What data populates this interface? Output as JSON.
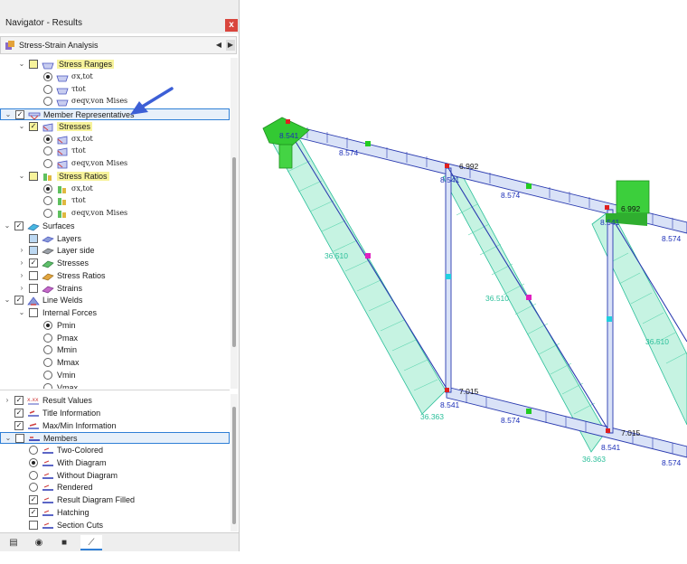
{
  "panel": {
    "title": "Navigator - Results",
    "close": "x",
    "module": "Stress-Strain Analysis"
  },
  "tree_top": [
    {
      "t": "check",
      "label": "Stress Ranges",
      "exp": "v",
      "checked": false,
      "hl": true,
      "lvl": 1,
      "icon": "stress-range-icon"
    },
    {
      "t": "radio",
      "label": "σx,tot",
      "on": true,
      "lvl": 2,
      "icon": "stress-range-icon"
    },
    {
      "t": "radio",
      "label": "τtot",
      "on": false,
      "lvl": 2,
      "icon": "stress-range-icon"
    },
    {
      "t": "radio",
      "label": "σeqv,von Mises",
      "on": false,
      "lvl": 2,
      "icon": "stress-range-icon"
    },
    {
      "t": "check",
      "label": "Member Representatives",
      "exp": "v",
      "checked": true,
      "lvl": 0,
      "icon": "member-representatives-icon",
      "sel": true
    },
    {
      "t": "check",
      "label": "Stresses",
      "exp": "v",
      "checked": true,
      "hl": true,
      "lvl": 1,
      "icon": "stress-icon"
    },
    {
      "t": "radio",
      "label": "σx,tot",
      "on": true,
      "lvl": 2,
      "icon": "stress-icon"
    },
    {
      "t": "radio",
      "label": "τtot",
      "on": false,
      "lvl": 2,
      "icon": "stress-icon"
    },
    {
      "t": "radio",
      "label": "σeqv,von Mises",
      "on": false,
      "lvl": 2,
      "icon": "stress-icon"
    },
    {
      "t": "check",
      "label": "Stress Ratios",
      "exp": "v",
      "checked": false,
      "hl": true,
      "lvl": 1,
      "icon": "stress-ratio-icon"
    },
    {
      "t": "radio",
      "label": "σx,tot",
      "on": true,
      "lvl": 2,
      "icon": "stress-ratio-icon"
    },
    {
      "t": "radio",
      "label": "τtot",
      "on": false,
      "lvl": 2,
      "icon": "stress-ratio-icon"
    },
    {
      "t": "radio",
      "label": "σeqv,von Mises",
      "on": false,
      "lvl": 2,
      "icon": "stress-ratio-icon"
    },
    {
      "t": "check",
      "label": "Surfaces",
      "exp": "v",
      "checked": true,
      "lvl": 0,
      "icon": "surfaces-icon"
    },
    {
      "t": "check",
      "label": "Layers",
      "exp": "",
      "checked": false,
      "lvl": 1,
      "icon": "layers-icon",
      "filled": true
    },
    {
      "t": "check",
      "label": "Layer side",
      "exp": ">",
      "checked": false,
      "lvl": 1,
      "icon": "layer-side-icon",
      "filled": true
    },
    {
      "t": "check",
      "label": "Stresses",
      "exp": ">",
      "checked": true,
      "lvl": 1,
      "icon": "surface-stresses-icon"
    },
    {
      "t": "check",
      "label": "Stress Ratios",
      "exp": ">",
      "checked": false,
      "lvl": 1,
      "icon": "surface-ratio-icon"
    },
    {
      "t": "check",
      "label": "Strains",
      "exp": ">",
      "checked": false,
      "lvl": 1,
      "icon": "strains-icon"
    },
    {
      "t": "check",
      "label": "Line Welds",
      "exp": "v",
      "checked": true,
      "lvl": 0,
      "icon": "line-welds-icon"
    },
    {
      "t": "check",
      "label": "Internal Forces",
      "exp": "v",
      "checked": false,
      "lvl": 1,
      "icon": ""
    },
    {
      "t": "radio",
      "label": "Pmin",
      "on": true,
      "lvl": 2,
      "icon": ""
    },
    {
      "t": "radio",
      "label": "Pmax",
      "on": false,
      "lvl": 2,
      "icon": ""
    },
    {
      "t": "radio",
      "label": "Mmin",
      "on": false,
      "lvl": 2,
      "icon": ""
    },
    {
      "t": "radio",
      "label": "Mmax",
      "on": false,
      "lvl": 2,
      "icon": ""
    },
    {
      "t": "radio",
      "label": "Vmin",
      "on": false,
      "lvl": 2,
      "icon": ""
    },
    {
      "t": "radio",
      "label": "Vmax",
      "on": false,
      "lvl": 2,
      "icon": ""
    }
  ],
  "tree_bottom": [
    {
      "t": "check",
      "label": "Result Values",
      "exp": ">",
      "checked": true,
      "lvl": 0,
      "icon": "result-values-icon"
    },
    {
      "t": "check",
      "label": "Title Information",
      "exp": "",
      "checked": true,
      "lvl": 0,
      "icon": "title-info-icon"
    },
    {
      "t": "check",
      "label": "Max/Min Information",
      "exp": "",
      "checked": true,
      "lvl": 0,
      "icon": "maxmin-info-icon"
    },
    {
      "t": "check",
      "label": "Members",
      "exp": "v",
      "checked": false,
      "lvl": 0,
      "icon": "members-icon",
      "sel": true
    },
    {
      "t": "radio",
      "label": "Two-Colored",
      "on": false,
      "lvl": 1,
      "icon": "member-display-icon"
    },
    {
      "t": "radio",
      "label": "With Diagram",
      "on": true,
      "lvl": 1,
      "icon": "member-display-icon"
    },
    {
      "t": "radio",
      "label": "Without Diagram",
      "on": false,
      "lvl": 1,
      "icon": "member-display-icon"
    },
    {
      "t": "radio",
      "label": "Rendered",
      "on": false,
      "lvl": 1,
      "icon": "member-display-icon"
    },
    {
      "t": "check",
      "label": "Result Diagram Filled",
      "exp": "",
      "checked": true,
      "lvl": 1,
      "icon": "member-display-icon"
    },
    {
      "t": "check",
      "label": "Hatching",
      "exp": "",
      "checked": true,
      "lvl": 1,
      "icon": "member-display-icon"
    },
    {
      "t": "check",
      "label": "Section Cuts",
      "exp": "",
      "checked": false,
      "lvl": 1,
      "icon": "member-display-icon"
    }
  ],
  "tabs": [
    {
      "name": "data-tab",
      "glyph": "▤"
    },
    {
      "name": "view-tab",
      "glyph": "◉"
    },
    {
      "name": "camera-tab",
      "glyph": "■"
    },
    {
      "name": "results-tab",
      "glyph": "⟋"
    }
  ],
  "viewport": {
    "labels": [
      {
        "text": "8.541",
        "c": "blue"
      },
      {
        "text": "8.574",
        "c": "blue"
      },
      {
        "text": "6.992",
        "c": "dark"
      },
      {
        "text": "8.541",
        "c": "blue"
      },
      {
        "text": "8.574",
        "c": "blue"
      },
      {
        "text": "6.992",
        "c": "dark"
      },
      {
        "text": "8.541",
        "c": "blue"
      },
      {
        "text": "8.574",
        "c": "blue"
      },
      {
        "text": "36.510",
        "c": "green"
      },
      {
        "text": "36.510",
        "c": "green"
      },
      {
        "text": "36.510",
        "c": "green"
      },
      {
        "text": "7.015",
        "c": "dark"
      },
      {
        "text": "8.541",
        "c": "blue"
      },
      {
        "text": "8.574",
        "c": "blue"
      },
      {
        "text": "36.363",
        "c": "green"
      },
      {
        "text": "7.015",
        "c": "dark"
      },
      {
        "text": "8.541",
        "c": "blue"
      },
      {
        "text": "36.363",
        "c": "green"
      },
      {
        "text": "8.574",
        "c": "blue"
      }
    ]
  },
  "colors": {
    "highlight": "#f7f39b",
    "selection": "#2f7fd6",
    "member": "#b9c8f0",
    "diagram": "#bff2de",
    "support": "#3ccf3c"
  }
}
